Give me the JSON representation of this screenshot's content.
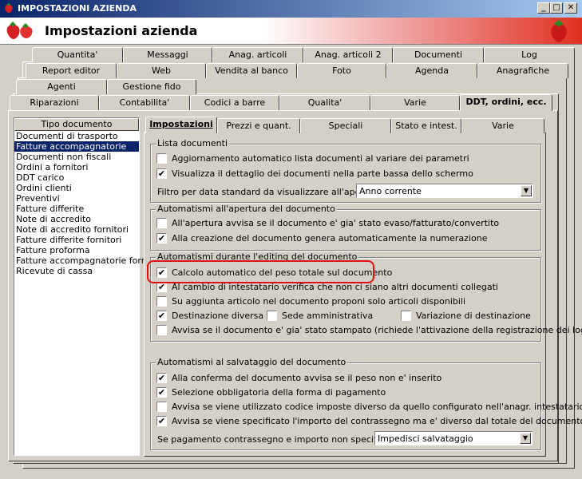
{
  "window": {
    "title": "IMPOSTAZIONI AZIENDA",
    "header_title": "Impostazioni azienda"
  },
  "top_tabs": {
    "row1": [
      "Quantita'",
      "Messaggi",
      "Anag. articoli",
      "Anag. articoli 2",
      "Documenti",
      "Log"
    ],
    "row2": [
      "Report editor",
      "Web",
      "Vendita al banco",
      "Foto",
      "Agenda",
      "Anagrafiche"
    ],
    "row3": [
      "Agenti",
      "Gestione fido"
    ],
    "row4": [
      "Riparazioni",
      "Contabilita'",
      "Codici a barre",
      "Qualita'",
      "Varie",
      "DDT, ordini, ecc."
    ]
  },
  "doc_list": {
    "header": "Tipo documento",
    "items": [
      "Documenti di trasporto",
      "Fatture accompagnatorie",
      "Documenti non fiscali",
      "Ordini a fornitori",
      "DDT carico",
      "Ordini clienti",
      "Preventivi",
      "Fatture differite",
      "Note di accredito",
      "Note di accredito fornitori",
      "Fatture differite fornitori",
      "Fatture proforma",
      "Fatture accompagnatorie fornitori",
      "Ricevute di cassa"
    ],
    "selected": "Fatture accompagnatorie"
  },
  "inner_tabs": [
    "Impostazioni",
    "Prezzi e quant.",
    "Speciali",
    "Stato e intest.",
    "Varie"
  ],
  "groups": {
    "lista": {
      "title": "Lista documenti",
      "cb1": "Aggiornamento automatico lista documenti al variare dei parametri",
      "cb2": "Visualizza il dettaglio dei documenti nella parte bassa dello schermo",
      "filter_label": "Filtro per data standard da visualizzare all'apertura :",
      "filter_value": "Anno corrente"
    },
    "apertura": {
      "title": "Automatismi all'apertura del documento",
      "cb1": "All'apertura avvisa se il documento e' gia' stato evaso/fatturato/convertito",
      "cb2": "Alla creazione del documento genera automaticamente la numerazione"
    },
    "editing": {
      "title": "Automatismi durante l'editing del documento",
      "cb1": "Calcolo automatico del peso totale sul documento",
      "cb2": "Al cambio di intestatario verifica che non ci siano altri documenti collegati",
      "cb3": "Su aggiunta articolo nel documento proponi solo articoli disponibili",
      "cb4": "Destinazione diversa",
      "cb5": "Sede amministrativa",
      "cb6": "Variazione di destinazione",
      "cb7": "Avvisa se il documento e' gia' stato stampato (richiede l'attivazione della registrazione dei log)"
    },
    "salvataggio": {
      "title": "Automatismi al salvataggio del documento",
      "cb1": "Alla conferma del documento avvisa se il peso non e' inserito",
      "cb2": "Selezione obbligatoria della forma di pagamento",
      "cb3": "Avvisa se viene utilizzato codice imposte diverso da quello configurato nell'anagr. intestatario",
      "cb4": "Avvisa se viene specificato l'importo del contrassegno ma e' diverso dal totale del documento",
      "combo_label": "Se pagamento contrassegno e importo non specificato :",
      "combo_value": "Impedisci salvataggio"
    }
  },
  "checks": {
    "checked_mark": "✔",
    "min": "_",
    "max": "□",
    "close": "✕"
  },
  "colors": {
    "accent_red": "#e01010",
    "selection": "#0a246a"
  }
}
